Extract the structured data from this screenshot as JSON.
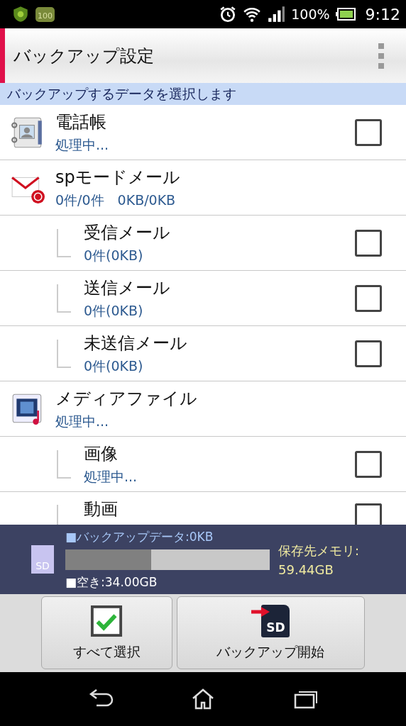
{
  "status_bar": {
    "app_badge": "100",
    "battery": "100%",
    "time": "9:12"
  },
  "action_bar": {
    "title": "バックアップ設定"
  },
  "section_header": "バックアップするデータを選択します",
  "items": [
    {
      "kind": "contacts",
      "title": "電話帳",
      "subtitle": "処理中...",
      "checked": false
    },
    {
      "kind": "mail",
      "title": "spモードメール",
      "subtitle": "0件/0件　0KB/0KB"
    },
    {
      "kind": "child",
      "title": "受信メール",
      "subtitle": "0件(0KB)",
      "checked": false
    },
    {
      "kind": "child",
      "title": "送信メール",
      "subtitle": "0件(0KB)",
      "checked": false
    },
    {
      "kind": "child",
      "title": "未送信メール",
      "subtitle": "0件(0KB)",
      "checked": false
    },
    {
      "kind": "media",
      "title": "メディアファイル",
      "subtitle": "処理中..."
    },
    {
      "kind": "child",
      "title": "画像",
      "subtitle": "処理中...",
      "checked": false
    },
    {
      "kind": "child",
      "title": "動画",
      "checked": false
    }
  ],
  "storage": {
    "icon_label": "SD",
    "backup_data": "■バックアップデータ:0KB",
    "level": 0.42,
    "free": "■空き:34.00GB",
    "destination_label": "保存先メモリ:",
    "destination_size": "59.44GB"
  },
  "buttons": [
    {
      "kind": "select_all",
      "label": "すべて選択"
    },
    {
      "kind": "backup",
      "label": "バックアップ開始",
      "icon_label": "SD"
    }
  ]
}
